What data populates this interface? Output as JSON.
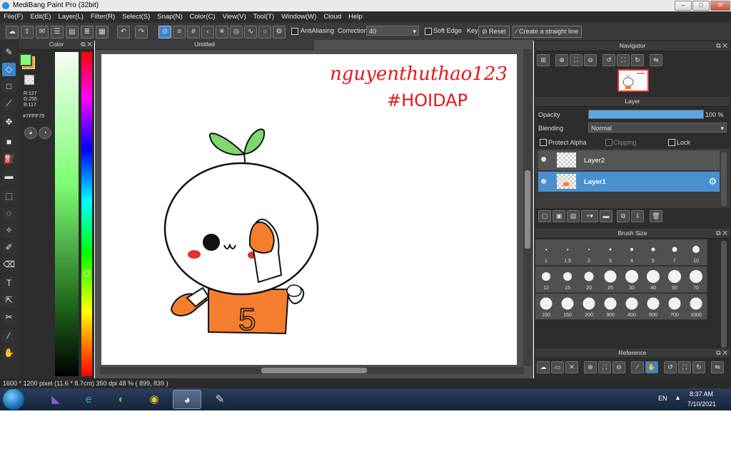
{
  "window": {
    "title": "MediBang Paint Pro (32bit)",
    "minimize": "–",
    "maximize": "□",
    "close": "✕"
  },
  "menu": [
    "File(F)",
    "Edit(E)",
    "Layer(L)",
    "Filter(R)",
    "Select(S)",
    "Snap(N)",
    "Color(C)",
    "View(V)",
    "Tool(T)",
    "Window(W)",
    "Cloud",
    "Help"
  ],
  "toolbar": {
    "antialiasing_label": "AntiAliasing",
    "correction_label": "Correction",
    "correction_value": "40",
    "soft_edge_label": "Soft Edge",
    "key_label": "Key",
    "reset_label": "Reset",
    "straight_line_label": "Create a straight line"
  },
  "color_panel": {
    "title": "Color",
    "r": "R:127",
    "g": "G:255",
    "b": "B:117",
    "hex": "#7FFF75",
    "fg_color": "#7FFF75",
    "bg_color": "#F5A623"
  },
  "canvas": {
    "tab_title": "Untitled",
    "annotation_line1": "nguyenthuthao123",
    "annotation_line2": "#HOIDAP",
    "number_on_shirt": "5"
  },
  "navigator": {
    "title": "Navigator"
  },
  "layer_panel": {
    "title": "Layer",
    "opacity_label": "Opacity",
    "opacity_value": "100 %",
    "opacity_fraction": 1.0,
    "blending_label": "Blending",
    "blending_value": "Normal",
    "protect_alpha": "Protect Alpha",
    "clipping": "Clipping",
    "lock": "Lock",
    "layers": [
      {
        "name": "Layer2",
        "selected": false
      },
      {
        "name": "Layer1",
        "selected": true
      }
    ]
  },
  "brush_size": {
    "title": "Brush Size",
    "sizes": [
      "1",
      "1.5",
      "2",
      "3",
      "4",
      "5",
      "7",
      "10",
      "12",
      "15",
      "20",
      "25",
      "30",
      "40",
      "50",
      "70",
      "100",
      "150",
      "200",
      "300",
      "400",
      "500",
      "700",
      "1000"
    ]
  },
  "reference": {
    "title": "Reference"
  },
  "status": {
    "size": "1600 * 1200 pixel",
    "physical": "(11.6 * 8.7cm)",
    "dpi": "350 dpi",
    "zoom": "48 %",
    "cursor": "( 899, 839 )"
  },
  "taskbar": {
    "language": "EN",
    "time": "8:37 AM",
    "date": "7/10/2021"
  }
}
